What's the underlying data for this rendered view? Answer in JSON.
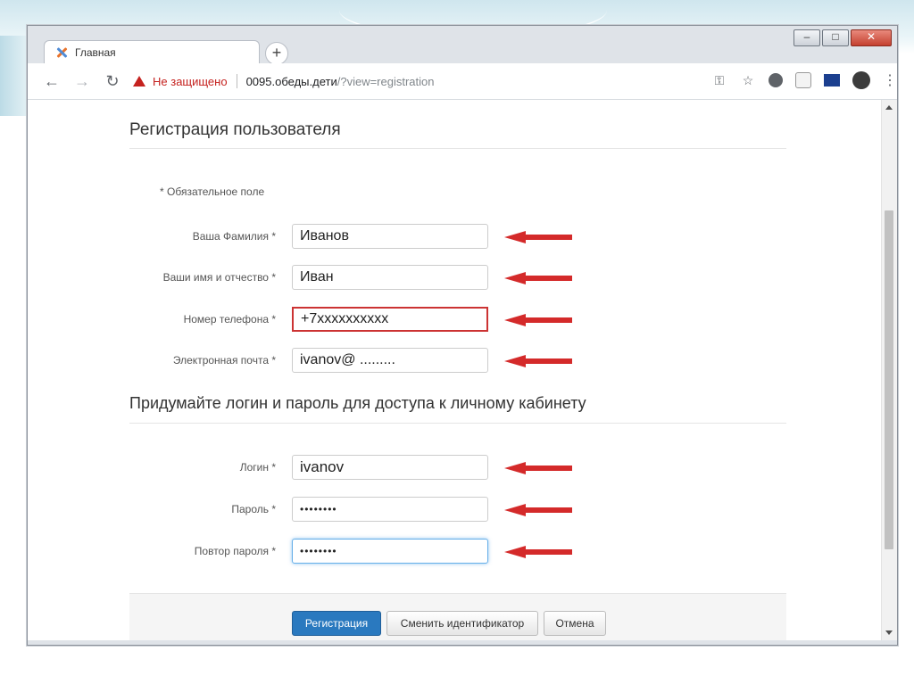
{
  "browser": {
    "tab_title": "Главная",
    "new_tab": "+",
    "security_warning": "Не защищено",
    "url_host": "0095.обеды.дети",
    "url_path": "/?view=registration",
    "window_controls": {
      "minimize": "–",
      "maximize": "□",
      "close": "✕"
    }
  },
  "page": {
    "title": "Регистрация пользователя",
    "required_note": "* Обязательное поле",
    "fields": [
      {
        "label": "Ваша Фамилия *",
        "value": "Иванов"
      },
      {
        "label": "Ваши имя и отчество *",
        "value": "Иван"
      },
      {
        "label": "Номер телефона *",
        "value": "+7xxxxxxxxxx"
      },
      {
        "label": "Электронная почта *",
        "value": "ivanov@ ........."
      }
    ],
    "login_section_title": "Придумайте логин и пароль для доступа к личному кабинету",
    "login_fields": [
      {
        "label": "Логин *",
        "value": "ivanov"
      },
      {
        "label": "Пароль *",
        "value": "••••••••"
      },
      {
        "label": "Повтор пароля *",
        "value": "••••••••"
      }
    ],
    "buttons": {
      "register": "Регистрация",
      "change_id": "Сменить идентификатор",
      "cancel": "Отмена"
    }
  },
  "colors": {
    "arrow": "#d42a2a",
    "primary_button": "#2a79bf",
    "error_border": "#cc3333",
    "warning": "#c5221f"
  }
}
